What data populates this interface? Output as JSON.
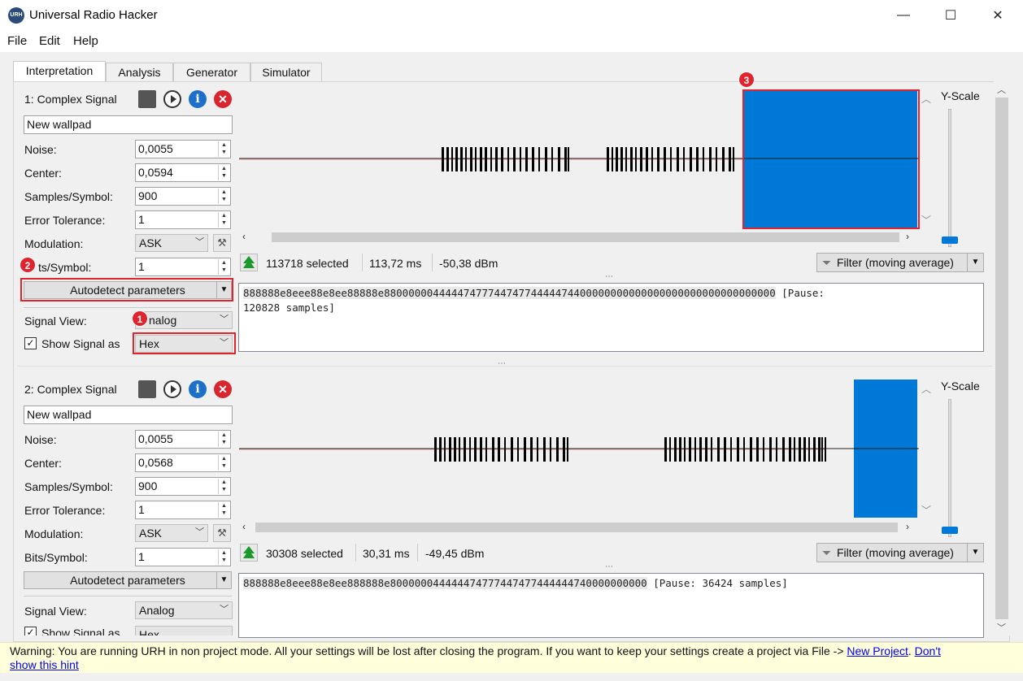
{
  "window": {
    "title": "Universal Radio Hacker",
    "icon_text": "URH",
    "minimize": "—",
    "maximize": "☐",
    "close": "✕"
  },
  "menu": [
    "File",
    "Edit",
    "Help"
  ],
  "tabs": [
    "Interpretation",
    "Analysis",
    "Generator",
    "Simulator"
  ],
  "signals": [
    {
      "header": "1: Complex Signal",
      "name": "New wallpad",
      "noise_label": "Noise:",
      "noise": "0,0055",
      "center_label": "Center:",
      "center": "0,0594",
      "sps_label": "Samples/Symbol:",
      "sps": "900",
      "err_label": "Error Tolerance:",
      "err": "1",
      "mod_label": "Modulation:",
      "mod": "ASK",
      "bps_label": "Bits/Symbol:",
      "bps_visible": "ts/Symbol:",
      "bps": "1",
      "autodetect": "Autodetect parameters",
      "view_label": "Signal View:",
      "view": "Analog",
      "view_visible": "nalog",
      "show_label": "Show Signal as",
      "show": "Hex",
      "yscale": "Y-Scale",
      "selected": "113718",
      "selected_suffix": "selected",
      "duration": "113,72 ms",
      "power": "-50,38 dBm",
      "filter": "Filter (moving average)",
      "hex_main": "888888e8eee88e8ee88888e8800000044444747774474774444474400000000000000000000000000000000",
      "hex_pause": "[Pause:",
      "hex_pause2": "120828 samples]"
    },
    {
      "header": "2: Complex Signal",
      "name": "New wallpad",
      "noise_label": "Noise:",
      "noise": "0,0055",
      "center_label": "Center:",
      "center": "0,0568",
      "sps_label": "Samples/Symbol:",
      "sps": "900",
      "err_label": "Error Tolerance:",
      "err": "1",
      "mod_label": "Modulation:",
      "mod": "ASK",
      "bps_label": "Bits/Symbol:",
      "bps": "1",
      "autodetect": "Autodetect parameters",
      "view_label": "Signal View:",
      "view": "Analog",
      "show_label": "Show Signal as",
      "show": "Hex",
      "yscale": "Y-Scale",
      "selected": "30308",
      "selected_suffix": "selected",
      "duration": "30,31 ms",
      "power": "-49,45 dBm",
      "filter": "Filter (moving average)",
      "hex_main": "888888e8eee88e8ee888888e800000044444474777447477444444740000000000",
      "hex_pause": "[Pause: 36424 samples]"
    }
  ],
  "badges": [
    "1",
    "2",
    "3"
  ],
  "status": {
    "text": "Warning: You are running URH in non project mode. All your settings will be lost after closing the program. If you want to keep your settings create a project via File -> ",
    "new_project": "New Project",
    "sep": ". ",
    "dont": "Don't",
    "show_hint": "show this hint"
  },
  "colors": {
    "accent": "#0078d7",
    "highlight": "#e0232d",
    "status_bg": "#ffffdc"
  }
}
